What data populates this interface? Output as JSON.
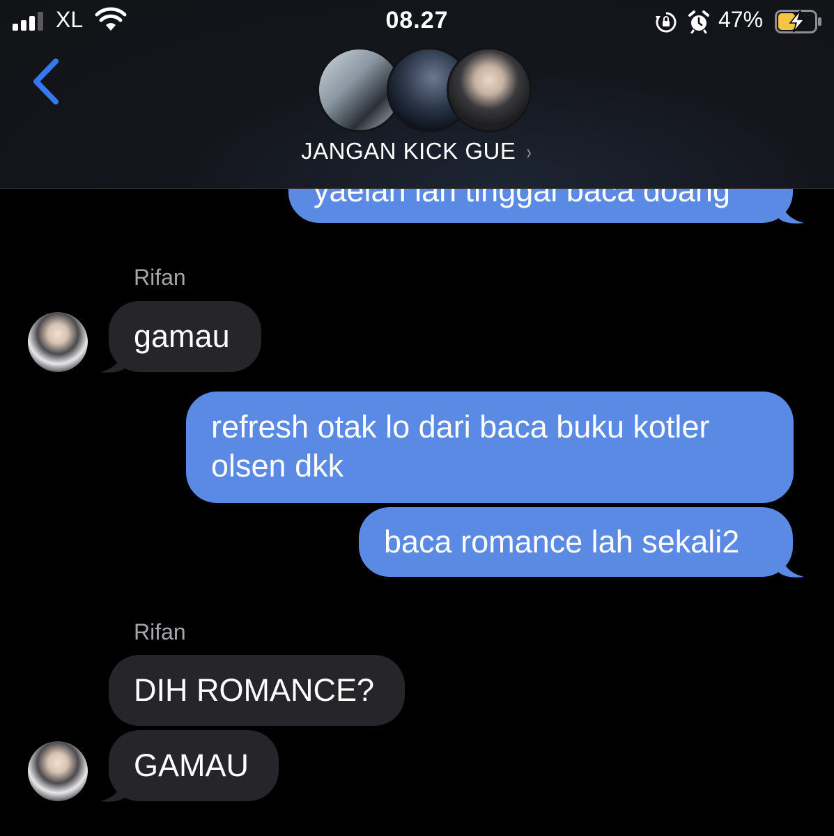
{
  "status_bar": {
    "carrier": "XL",
    "time": "08.27",
    "battery_percent": "47%",
    "battery_level": 0.47,
    "charging": true
  },
  "header": {
    "group_name": "JANGAN KICK GUE",
    "chevron": "›",
    "back_icon": "chevron-left-icon",
    "accent_color": "#3478f6"
  },
  "messages": [
    {
      "direction": "outgoing",
      "text": "yaelah lah tinggal baca doang",
      "partially_hidden": true
    },
    {
      "direction": "incoming",
      "sender": "Rifan",
      "text": "gamau"
    },
    {
      "direction": "outgoing",
      "lines": [
        "refresh otak lo dari baca buku kotler",
        "olsen dkk"
      ]
    },
    {
      "direction": "outgoing",
      "text": "baca romance lah sekali2"
    },
    {
      "direction": "incoming",
      "sender": "Rifan",
      "text": "DIH ROMANCE?"
    },
    {
      "direction": "incoming",
      "text": "GAMAU"
    }
  ],
  "colors": {
    "outgoing_bubble": "#5b8ae5",
    "incoming_bubble": "#26262a",
    "background": "#000000",
    "sender_label": "#a6a6ab"
  }
}
